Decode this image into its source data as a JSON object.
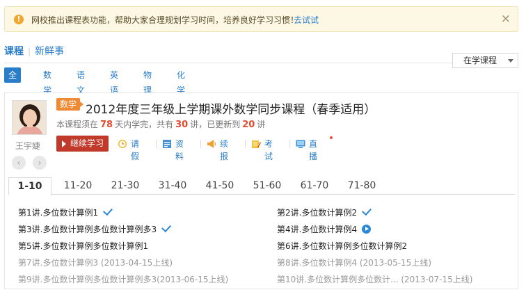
{
  "notice": {
    "warn_icon": "warning-icon",
    "message": "网校推出课程表功能，帮助大家合理规划学习时间，培养良好学习习惯！",
    "try_label": "去试试",
    "close_label": "×"
  },
  "tabs": {
    "primary": "课程",
    "secondary": "新鲜事"
  },
  "filter": {
    "selected": "在学课程"
  },
  "subjects": [
    "全部",
    "数学",
    "语文",
    "英语",
    "物理",
    "化学"
  ],
  "course": {
    "subject_tag": "数学",
    "title": "2012年度三年级上学期课外数学同步课程（春季适用）",
    "meta": {
      "p1": "本课程须在",
      "days": "78",
      "p2": "天内学完，共有",
      "total": "30",
      "p3": "讲，已更新到",
      "updated": "20",
      "p4": "讲"
    },
    "teacher": "王宇婕",
    "continue_label": "继续学习",
    "actions": [
      "请假",
      "资料",
      "续报",
      "考试",
      "直播"
    ],
    "prev_label": "‹",
    "next_label": "›"
  },
  "range_tabs": [
    "1-10",
    "11-20",
    "21-30",
    "31-40",
    "41-50",
    "51-60",
    "61-70",
    "71-80"
  ],
  "lessons": [
    {
      "text": "第1讲.多位数计算例1",
      "status": "done"
    },
    {
      "text": "第2讲.多位数计算例2",
      "status": "done"
    },
    {
      "text": "第3讲.多位数计算例多位数计算例多3",
      "status": "done"
    },
    {
      "text": "第4讲.多位数计算例4",
      "status": "play"
    },
    {
      "text": "第5讲.多位数计算例多位数计算例1",
      "status": "available"
    },
    {
      "text": "第6讲.多位数计算例多位数计算例2",
      "status": "available"
    },
    {
      "text": "第7讲.多位数计算例3 (2013-04-15上线)",
      "status": "upcoming"
    },
    {
      "text": "第8讲.多位数计算例4 (2013-05-15上线)",
      "status": "upcoming"
    },
    {
      "text": "第9讲.多位数计算例多位数计算例多3(2013-06-15上线)",
      "status": "upcoming"
    },
    {
      "text": "第10讲.多位数计算例多位数计... (2013-07-15上线)",
      "status": "upcoming"
    }
  ],
  "colors": {
    "accent": "#2a7dc9",
    "tag": "#f08a32",
    "continue": "#c0392b",
    "highlight": "#e34a2f"
  }
}
